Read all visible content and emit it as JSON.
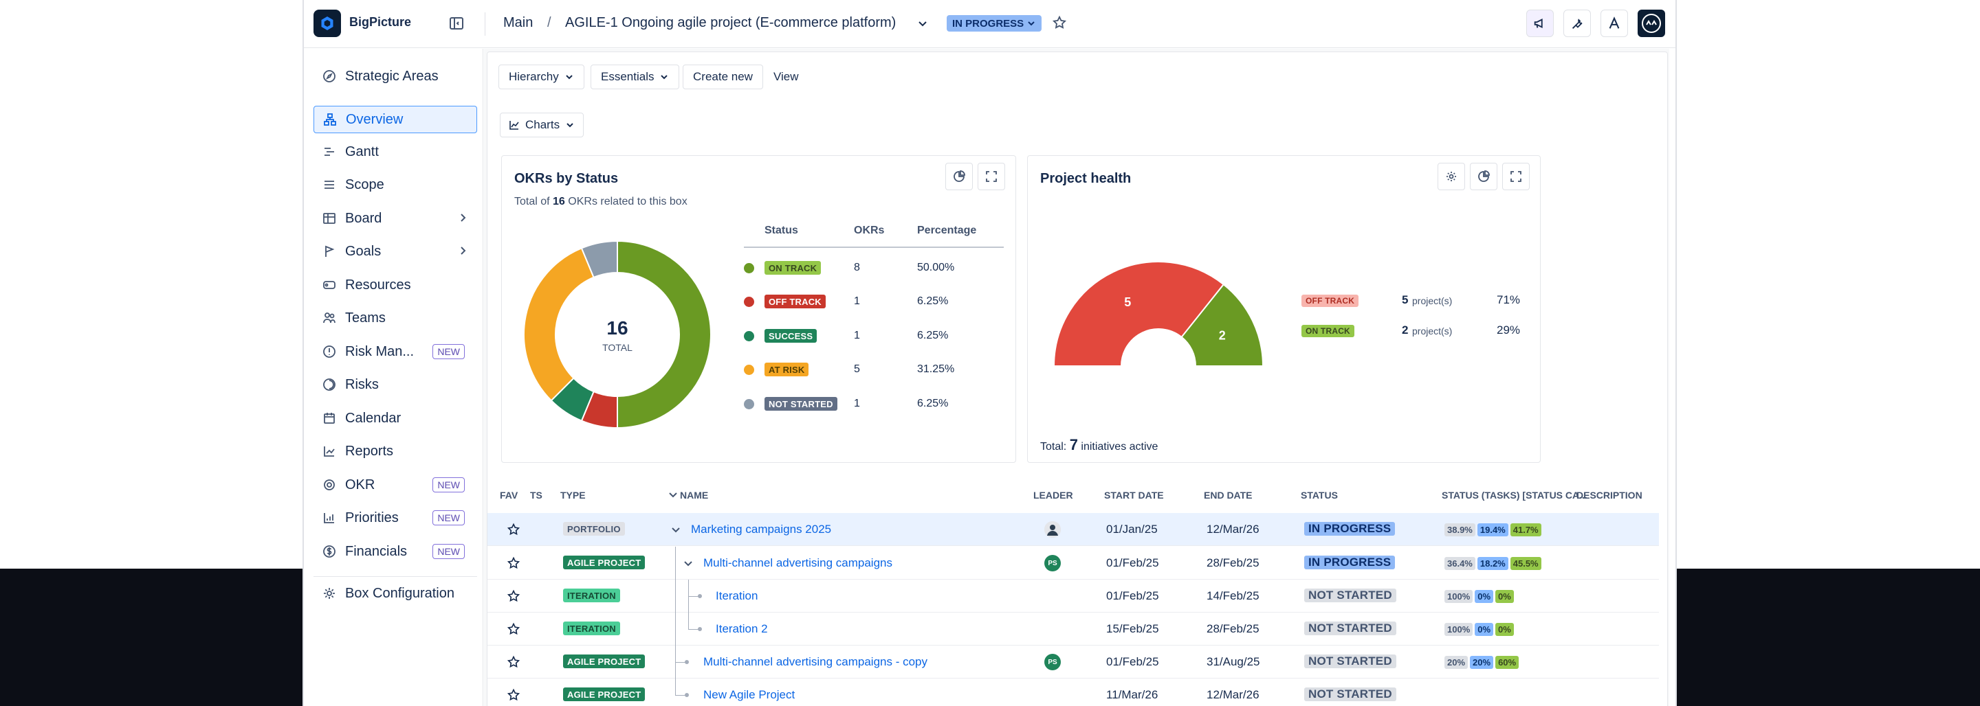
{
  "app": {
    "brand": "BigPicture"
  },
  "breadcrumb": {
    "main": "Main",
    "separator": "/",
    "project": "AGILE-1  Ongoing agile project (E-commerce platform)",
    "status": "IN PROGRESS"
  },
  "sidebar": {
    "items": [
      {
        "label": "Strategic Areas",
        "icon": "compass-icon"
      },
      {
        "label": "Overview",
        "icon": "hierarchy-icon",
        "active": true
      },
      {
        "label": "Gantt",
        "icon": "gantt-icon"
      },
      {
        "label": "Scope",
        "icon": "list-icon"
      },
      {
        "label": "Board",
        "icon": "board-icon",
        "expandable": true
      },
      {
        "label": "Goals",
        "icon": "goals-icon",
        "expandable": true
      },
      {
        "label": "Resources",
        "icon": "resources-icon"
      },
      {
        "label": "Teams",
        "icon": "teams-icon"
      },
      {
        "label": "Risk Man...",
        "icon": "risk-management-icon",
        "badge": "NEW"
      },
      {
        "label": "Risks",
        "icon": "risks-icon"
      },
      {
        "label": "Calendar",
        "icon": "calendar-icon"
      },
      {
        "label": "Reports",
        "icon": "reports-icon"
      },
      {
        "label": "OKR",
        "icon": "okr-icon",
        "badge": "NEW"
      },
      {
        "label": "Priorities",
        "icon": "priorities-icon",
        "badge": "NEW"
      },
      {
        "label": "Financials",
        "icon": "financials-icon",
        "badge": "NEW"
      },
      {
        "label": "Box Configuration",
        "icon": "gear-icon"
      }
    ]
  },
  "toolbar": {
    "hierarchy": "Hierarchy",
    "essentials": "Essentials",
    "create_new": "Create new",
    "view": "View",
    "charts": "Charts"
  },
  "okr_card": {
    "title": "OKRs by Status",
    "total_prefix": "Total of ",
    "total_count": "16",
    "total_suffix": " OKRs related to this box",
    "center_value": "16",
    "center_label": "TOTAL",
    "headers": {
      "status": "Status",
      "okrs": "OKRs",
      "percentage": "Percentage"
    },
    "rows": [
      {
        "status": "ON TRACK",
        "okrs": "8",
        "percentage": "50.00%",
        "color": "#6a9a23"
      },
      {
        "status": "OFF TRACK",
        "okrs": "1",
        "percentage": "6.25%",
        "color": "#c9372c"
      },
      {
        "status": "SUCCESS",
        "okrs": "1",
        "percentage": "6.25%",
        "color": "#1f845a"
      },
      {
        "status": "AT RISK",
        "okrs": "5",
        "percentage": "31.25%",
        "color": "#f5a623"
      },
      {
        "status": "NOT STARTED",
        "okrs": "1",
        "percentage": "6.25%",
        "color": "#8c9bab"
      }
    ]
  },
  "health_card": {
    "title": "Project health",
    "legend": [
      {
        "status": "OFF TRACK",
        "count": "5",
        "unit": "project(s)",
        "percent": "71%",
        "color": "#e2483d"
      },
      {
        "status": "ON TRACK",
        "count": "2",
        "unit": "project(s)",
        "percent": "29%",
        "color": "#6a9a23"
      }
    ],
    "total_prefix": "Total: ",
    "total_count": "7",
    "total_suffix": " initiatives active"
  },
  "chart_data": [
    {
      "type": "pie",
      "title": "OKRs by Status",
      "categories": [
        "ON TRACK",
        "OFF TRACK",
        "SUCCESS",
        "AT RISK",
        "NOT STARTED"
      ],
      "values": [
        8,
        1,
        1,
        5,
        1
      ],
      "colors": [
        "#6a9a23",
        "#c9372c",
        "#1f845a",
        "#f5a623",
        "#8c9bab"
      ],
      "donut": true
    },
    {
      "type": "pie",
      "title": "Project health",
      "categories": [
        "OFF TRACK",
        "ON TRACK"
      ],
      "values": [
        5,
        2
      ],
      "colors": [
        "#e2483d",
        "#6a9a23"
      ],
      "semicircle": true
    }
  ],
  "table": {
    "headers": {
      "fav": "FAV",
      "ts": "TS",
      "type": "TYPE",
      "name": "NAME",
      "leader": "LEADER",
      "start": "START DATE",
      "end": "END DATE",
      "status": "STATUS",
      "status_tasks": "STATUS (TASKS) [STATUS CA...",
      "description": "DESCRIPTION"
    },
    "rows": [
      {
        "type": "PORTFOLIO",
        "name": "Marketing campaigns 2025",
        "leader": "photo",
        "start": "01/Jan/25",
        "end": "12/Mar/26",
        "status": "IN PROGRESS",
        "pcts": [
          "38.9%",
          "19.4%",
          "41.7%"
        ]
      },
      {
        "type": "AGILE PROJECT",
        "name": "Multi-channel advertising campaigns",
        "leader": "PS",
        "start": "01/Feb/25",
        "end": "28/Feb/25",
        "status": "IN PROGRESS",
        "pcts": [
          "36.4%",
          "18.2%",
          "45.5%"
        ]
      },
      {
        "type": "ITERATION",
        "name": "Iteration",
        "leader": "",
        "start": "01/Feb/25",
        "end": "14/Feb/25",
        "status": "NOT STARTED",
        "pcts": [
          "100%",
          "0%",
          "0%"
        ]
      },
      {
        "type": "ITERATION",
        "name": "Iteration 2",
        "leader": "",
        "start": "15/Feb/25",
        "end": "28/Feb/25",
        "status": "NOT STARTED",
        "pcts": [
          "100%",
          "0%",
          "0%"
        ]
      },
      {
        "type": "AGILE PROJECT",
        "name": "Multi-channel advertising campaigns - copy",
        "leader": "PS",
        "start": "01/Feb/25",
        "end": "31/Aug/25",
        "status": "NOT STARTED",
        "pcts": [
          "20%",
          "20%",
          "60%"
        ]
      },
      {
        "type": "AGILE PROJECT",
        "name": "New Agile Project",
        "leader": "",
        "start": "11/Mar/26",
        "end": "12/Mar/26",
        "status": "NOT STARTED",
        "pcts": []
      }
    ]
  }
}
